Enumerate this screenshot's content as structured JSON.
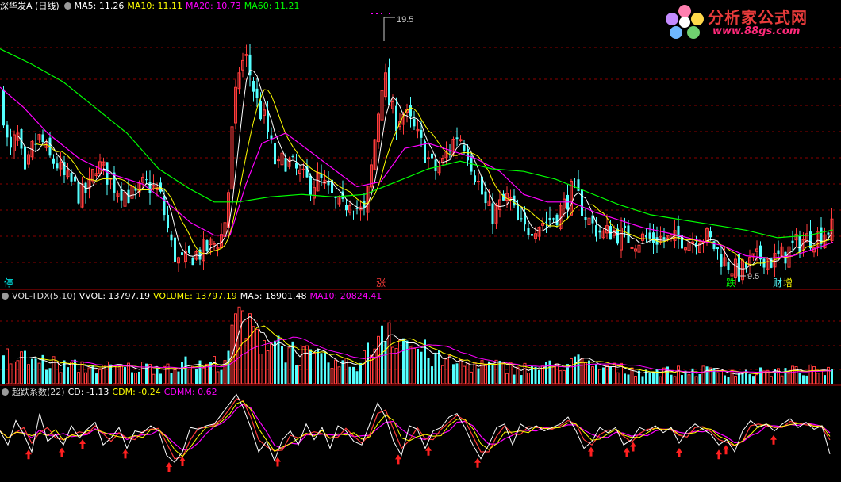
{
  "header": {
    "stock_name": "深华发A (日线)",
    "ma5": "MA5: 11.26",
    "ma10": "MA10: 11.11",
    "ma20": "MA20: 10.73",
    "ma60": "MA60: 11.21"
  },
  "volume_header": {
    "indicator": "VOL-TDX(5,10)",
    "vvol": "VVOL: 13797.19",
    "volume": "VOLUME: 13797.19",
    "ma5": "MA5: 18901.48",
    "ma10": "MA10: 20824.41"
  },
  "osc_header": {
    "indicator": "超跌系数(22)",
    "cd": "CD: -1.13",
    "cdm": "CDM: -0.24",
    "cdmm": "CDMM: 0.62"
  },
  "price_annotations": {
    "high_label": "19.50",
    "low_label": "9.50"
  },
  "markers": {
    "halt": "停",
    "up": "涨",
    "down": "跌",
    "earnings": "财",
    "increase": "增"
  },
  "logo": {
    "title": "分析家公式网",
    "url": "www.88gs.com"
  },
  "colors": {
    "up": "#ff3b3b",
    "down": "#54ffff",
    "ma5": "#ffffff",
    "ma10": "#ffff00",
    "ma20": "#ff00ff",
    "ma60": "#00ff00",
    "vvol": "#ffffff",
    "vol_ma5": "#ffffff",
    "vol_ma10": "#ff00ff",
    "cd": "#ffffff",
    "cdm": "#ff3b3b",
    "cdmm": "#ff00ff",
    "buy_arrow": "#ff2020",
    "grid": "#8b0000"
  },
  "chart_data": {
    "type": "candlestick",
    "price_high": 19.5,
    "price_low": 9.5,
    "ma_current": {
      "MA5": 11.26,
      "MA10": 11.11,
      "MA20": 10.73,
      "MA60": 11.21
    },
    "price_path": [
      [
        0,
        16.5
      ],
      [
        10,
        14.0
      ],
      [
        20,
        15.0
      ],
      [
        30,
        13.2
      ],
      [
        40,
        14.5
      ],
      [
        50,
        14.8
      ],
      [
        60,
        14.0
      ],
      [
        70,
        13.8
      ],
      [
        80,
        13.2
      ],
      [
        90,
        13.0
      ],
      [
        100,
        12.5
      ],
      [
        110,
        12.8
      ],
      [
        120,
        13.8
      ],
      [
        130,
        13.5
      ],
      [
        140,
        13.0
      ],
      [
        150,
        12.8
      ],
      [
        160,
        12.6
      ],
      [
        170,
        12.5
      ],
      [
        180,
        13.0
      ],
      [
        190,
        12.9
      ],
      [
        200,
        12.6
      ],
      [
        208,
        11.5
      ],
      [
        215,
        10.5
      ],
      [
        222,
        10.0
      ],
      [
        230,
        9.9
      ],
      [
        240,
        10.2
      ],
      [
        250,
        10.3
      ],
      [
        260,
        10.5
      ],
      [
        270,
        10.7
      ],
      [
        278,
        11.0
      ],
      [
        285,
        12.0
      ],
      [
        292,
        15.5
      ],
      [
        300,
        17.5
      ],
      [
        308,
        18.0
      ],
      [
        316,
        17.0
      ],
      [
        324,
        16.0
      ],
      [
        332,
        15.5
      ],
      [
        340,
        14.5
      ],
      [
        348,
        13.5
      ],
      [
        356,
        14.0
      ],
      [
        364,
        13.8
      ],
      [
        372,
        13.5
      ],
      [
        380,
        13.2
      ],
      [
        390,
        13.0
      ],
      [
        400,
        13.2
      ],
      [
        410,
        12.8
      ],
      [
        420,
        12.3
      ],
      [
        430,
        12.0
      ],
      [
        440,
        12.5
      ],
      [
        450,
        12.0
      ],
      [
        458,
        11.8
      ],
      [
        466,
        13.5
      ],
      [
        474,
        15.5
      ],
      [
        482,
        17.5
      ],
      [
        490,
        16.0
      ],
      [
        498,
        15.5
      ],
      [
        506,
        15.8
      ],
      [
        514,
        15.5
      ],
      [
        522,
        15.0
      ],
      [
        530,
        14.5
      ],
      [
        538,
        14.0
      ],
      [
        546,
        13.5
      ],
      [
        556,
        13.8
      ],
      [
        566,
        14.5
      ],
      [
        576,
        15.0
      ],
      [
        586,
        14.5
      ],
      [
        596,
        13.5
      ],
      [
        604,
        12.8
      ],
      [
        612,
        12.0
      ],
      [
        620,
        11.8
      ],
      [
        630,
        12.2
      ],
      [
        640,
        12.5
      ],
      [
        650,
        11.5
      ],
      [
        660,
        11.2
      ],
      [
        670,
        11.4
      ],
      [
        680,
        11.5
      ],
      [
        690,
        11.6
      ],
      [
        700,
        11.8
      ],
      [
        710,
        12.2
      ],
      [
        720,
        12.8
      ],
      [
        728,
        12.4
      ],
      [
        736,
        11.8
      ],
      [
        744,
        11.4
      ],
      [
        752,
        11.2
      ],
      [
        760,
        11.0
      ],
      [
        770,
        11.2
      ],
      [
        780,
        11.0
      ],
      [
        790,
        10.9
      ],
      [
        800,
        10.8
      ],
      [
        810,
        10.9
      ],
      [
        820,
        10.8
      ],
      [
        830,
        10.9
      ],
      [
        840,
        10.8
      ],
      [
        850,
        10.8
      ],
      [
        860,
        10.9
      ],
      [
        870,
        10.8
      ],
      [
        880,
        11.0
      ],
      [
        890,
        10.9
      ],
      [
        900,
        10.5
      ],
      [
        910,
        10.0
      ],
      [
        920,
        9.8
      ],
      [
        930,
        9.5
      ],
      [
        940,
        9.8
      ],
      [
        950,
        10.0
      ],
      [
        960,
        10.2
      ],
      [
        970,
        10.0
      ],
      [
        980,
        10.1
      ],
      [
        990,
        10.3
      ],
      [
        1000,
        10.6
      ],
      [
        1010,
        10.8
      ],
      [
        1020,
        10.9
      ],
      [
        1030,
        11.0
      ],
      [
        1040,
        11.2
      ],
      [
        1048,
        11.26
      ]
    ],
    "ma60_path": [
      [
        0,
        18.3
      ],
      [
        40,
        17.7
      ],
      [
        80,
        17.0
      ],
      [
        120,
        16.0
      ],
      [
        160,
        15.0
      ],
      [
        200,
        13.6
      ],
      [
        240,
        12.8
      ],
      [
        270,
        12.3
      ],
      [
        300,
        12.3
      ],
      [
        340,
        12.5
      ],
      [
        380,
        12.6
      ],
      [
        420,
        12.5
      ],
      [
        460,
        12.6
      ],
      [
        500,
        13.1
      ],
      [
        540,
        13.6
      ],
      [
        580,
        13.9
      ],
      [
        620,
        13.6
      ],
      [
        660,
        13.5
      ],
      [
        700,
        13.2
      ],
      [
        740,
        12.7
      ],
      [
        780,
        12.2
      ],
      [
        820,
        11.8
      ],
      [
        860,
        11.6
      ],
      [
        900,
        11.4
      ],
      [
        940,
        11.2
      ],
      [
        980,
        10.9
      ],
      [
        1020,
        11.0
      ],
      [
        1050,
        11.21
      ]
    ],
    "ma20_path": [
      [
        0,
        16.8
      ],
      [
        30,
        16.0
      ],
      [
        60,
        15.0
      ],
      [
        100,
        14.0
      ],
      [
        140,
        13.4
      ],
      [
        180,
        13.0
      ],
      [
        210,
        12.3
      ],
      [
        240,
        11.5
      ],
      [
        270,
        11.0
      ],
      [
        290,
        11.0
      ],
      [
        310,
        13.0
      ],
      [
        330,
        14.6
      ],
      [
        360,
        15.0
      ],
      [
        390,
        14.3
      ],
      [
        420,
        13.6
      ],
      [
        450,
        12.9
      ],
      [
        480,
        13.1
      ],
      [
        510,
        14.4
      ],
      [
        540,
        14.6
      ],
      [
        570,
        14.3
      ],
      [
        600,
        14.0
      ],
      [
        630,
        13.5
      ],
      [
        660,
        12.6
      ],
      [
        690,
        12.3
      ],
      [
        720,
        12.3
      ],
      [
        750,
        11.9
      ],
      [
        780,
        11.6
      ],
      [
        810,
        11.3
      ],
      [
        840,
        11.1
      ],
      [
        880,
        10.8
      ],
      [
        910,
        10.6
      ],
      [
        940,
        10.2
      ],
      [
        970,
        10.1
      ],
      [
        1000,
        10.2
      ],
      [
        1030,
        10.5
      ],
      [
        1050,
        10.73
      ]
    ],
    "volume": {
      "current": 13797.19,
      "ma5": 18901.48,
      "ma10": 20824.41,
      "profile": [
        [
          0,
          2.4
        ],
        [
          40,
          2.2
        ],
        [
          80,
          1.6
        ],
        [
          120,
          1.5
        ],
        [
          160,
          1.4
        ],
        [
          200,
          1.6
        ],
        [
          230,
          1.8
        ],
        [
          260,
          1.6
        ],
        [
          280,
          2.2
        ],
        [
          290,
          3.5
        ],
        [
          300,
          6.5
        ],
        [
          310,
          4.8
        ],
        [
          320,
          4.2
        ],
        [
          340,
          4.4
        ],
        [
          360,
          3.2
        ],
        [
          380,
          2.6
        ],
        [
          400,
          2.2
        ],
        [
          420,
          1.8
        ],
        [
          440,
          1.6
        ],
        [
          460,
          2.5
        ],
        [
          475,
          4.6
        ],
        [
          485,
          6.0
        ],
        [
          495,
          5.0
        ],
        [
          510,
          3.8
        ],
        [
          530,
          3.0
        ],
        [
          550,
          2.2
        ],
        [
          580,
          1.8
        ],
        [
          620,
          1.6
        ],
        [
          660,
          1.4
        ],
        [
          700,
          1.6
        ],
        [
          720,
          2.2
        ],
        [
          740,
          1.6
        ],
        [
          800,
          1.2
        ],
        [
          860,
          1.1
        ],
        [
          900,
          1.2
        ],
        [
          940,
          1.0
        ],
        [
          980,
          1.1
        ],
        [
          1020,
          1.2
        ],
        [
          1050,
          1.0
        ]
      ],
      "scale_max": 8.0
    },
    "oscillator": {
      "CD": -1.13,
      "CDM": -0.24,
      "CDMM": 0.62,
      "cd_path": [
        [
          0,
          0.2
        ],
        [
          10,
          -0.6
        ],
        [
          20,
          0.8
        ],
        [
          30,
          0.0
        ],
        [
          40,
          -1.0
        ],
        [
          50,
          1.2
        ],
        [
          60,
          -0.4
        ],
        [
          70,
          0.0
        ],
        [
          80,
          -0.6
        ],
        [
          90,
          0.5
        ],
        [
          100,
          -0.2
        ],
        [
          110,
          0.3
        ],
        [
          120,
          0.7
        ],
        [
          130,
          -0.6
        ],
        [
          140,
          -0.2
        ],
        [
          150,
          0.4
        ],
        [
          160,
          -0.8
        ],
        [
          170,
          0.2
        ],
        [
          180,
          0.1
        ],
        [
          190,
          0.5
        ],
        [
          200,
          0.2
        ],
        [
          210,
          -1.2
        ],
        [
          220,
          -1.6
        ],
        [
          230,
          -1.0
        ],
        [
          240,
          0.4
        ],
        [
          250,
          0.3
        ],
        [
          260,
          0.5
        ],
        [
          270,
          0.6
        ],
        [
          280,
          1.2
        ],
        [
          290,
          1.8
        ],
        [
          298,
          2.3
        ],
        [
          306,
          1.6
        ],
        [
          316,
          0.4
        ],
        [
          326,
          -1.0
        ],
        [
          336,
          -0.4
        ],
        [
          346,
          -1.5
        ],
        [
          356,
          -0.3
        ],
        [
          366,
          0.2
        ],
        [
          376,
          -0.6
        ],
        [
          386,
          0.6
        ],
        [
          396,
          -0.3
        ],
        [
          406,
          0.4
        ],
        [
          416,
          -0.8
        ],
        [
          426,
          0.5
        ],
        [
          436,
          0.2
        ],
        [
          446,
          -0.4
        ],
        [
          456,
          -0.6
        ],
        [
          466,
          0.6
        ],
        [
          476,
          1.8
        ],
        [
          486,
          1.0
        ],
        [
          496,
          -0.4
        ],
        [
          506,
          -1.2
        ],
        [
          516,
          0.5
        ],
        [
          526,
          0.3
        ],
        [
          536,
          -0.8
        ],
        [
          546,
          0.2
        ],
        [
          556,
          0.4
        ],
        [
          566,
          1.0
        ],
        [
          576,
          1.2
        ],
        [
          586,
          0.4
        ],
        [
          596,
          -0.6
        ],
        [
          606,
          -1.4
        ],
        [
          616,
          -0.6
        ],
        [
          626,
          0.4
        ],
        [
          636,
          0.6
        ],
        [
          646,
          -0.6
        ],
        [
          656,
          0.6
        ],
        [
          666,
          0.3
        ],
        [
          676,
          0.5
        ],
        [
          686,
          0.2
        ],
        [
          696,
          0.4
        ],
        [
          706,
          0.6
        ],
        [
          716,
          1.0
        ],
        [
          726,
          0.2
        ],
        [
          736,
          -0.8
        ],
        [
          746,
          -0.4
        ],
        [
          756,
          0.4
        ],
        [
          766,
          0.1
        ],
        [
          776,
          0.4
        ],
        [
          786,
          -0.6
        ],
        [
          796,
          -0.3
        ],
        [
          806,
          0.4
        ],
        [
          816,
          0.2
        ],
        [
          826,
          0.5
        ],
        [
          836,
          0.1
        ],
        [
          846,
          0.4
        ],
        [
          856,
          -0.5
        ],
        [
          866,
          0.2
        ],
        [
          876,
          0.6
        ],
        [
          886,
          0.3
        ],
        [
          896,
          0.0
        ],
        [
          906,
          -0.6
        ],
        [
          916,
          -0.3
        ],
        [
          926,
          -1.0
        ],
        [
          936,
          0.2
        ],
        [
          946,
          0.8
        ],
        [
          956,
          0.4
        ],
        [
          966,
          0.6
        ],
        [
          976,
          0.2
        ],
        [
          986,
          0.6
        ],
        [
          996,
          0.9
        ],
        [
          1006,
          0.4
        ],
        [
          1016,
          0.7
        ],
        [
          1026,
          0.3
        ],
        [
          1036,
          0.5
        ],
        [
          1046,
          -1.13
        ]
      ],
      "buy_signals_x": [
        36,
        78,
        104,
        158,
        213,
        230,
        350,
        502,
        540,
        602,
        745,
        790,
        798,
        856,
        906,
        915,
        975
      ],
      "range": [
        -2.0,
        2.6
      ]
    }
  }
}
